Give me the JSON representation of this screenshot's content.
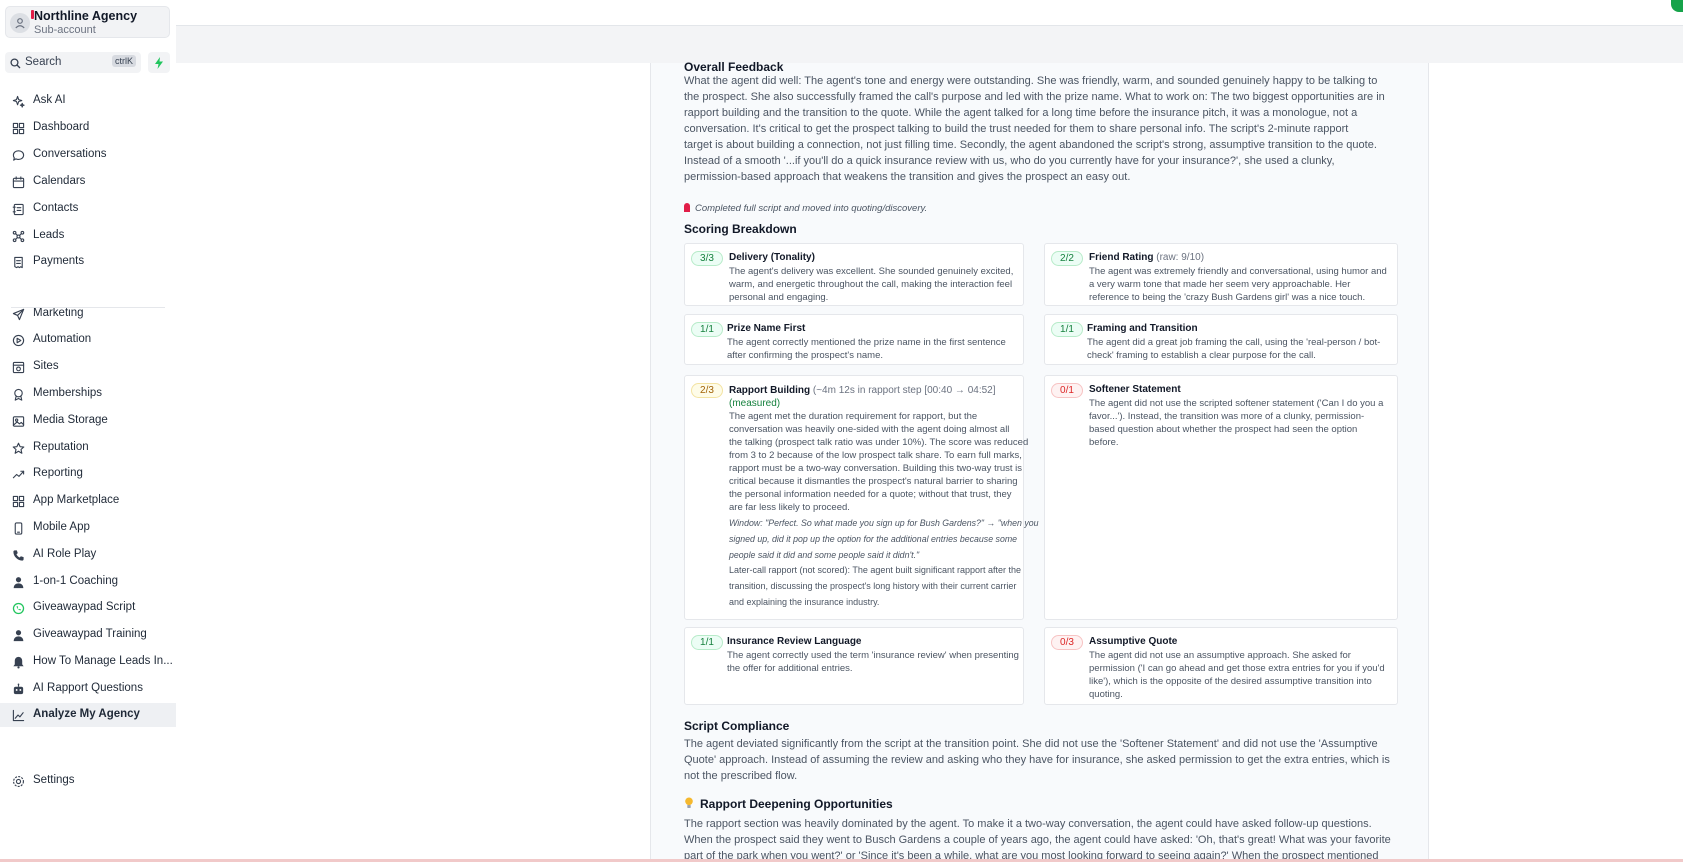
{
  "account": {
    "name": "Northline Agency",
    "subtitle": "Sub-account"
  },
  "search": {
    "label": "Search",
    "shortcut": "ctrlK"
  },
  "nav": [
    {
      "label": "Ask AI",
      "icon": "sparkle-icon"
    },
    {
      "label": "Dashboard",
      "icon": "grid-icon"
    },
    {
      "label": "Conversations",
      "icon": "chat-bubble-icon"
    },
    {
      "label": "Calendars",
      "icon": "calendar-icon"
    },
    {
      "label": "Contacts",
      "icon": "contacts-icon"
    },
    {
      "label": "Leads",
      "icon": "network-icon"
    },
    {
      "label": "Payments",
      "icon": "receipt-icon"
    },
    {
      "label": "Marketing",
      "icon": "send-icon"
    },
    {
      "label": "Automation",
      "icon": "automation-icon"
    },
    {
      "label": "Sites",
      "icon": "sites-icon"
    },
    {
      "label": "Memberships",
      "icon": "award-icon"
    },
    {
      "label": "Media Storage",
      "icon": "image-icon"
    },
    {
      "label": "Reputation",
      "icon": "star-icon"
    },
    {
      "label": "Reporting",
      "icon": "trend-icon"
    },
    {
      "label": "App Marketplace",
      "icon": "apps-icon"
    },
    {
      "label": "Mobile App",
      "icon": "phone-icon"
    },
    {
      "label": "AI Role Play",
      "icon": "phone-call-icon"
    },
    {
      "label": "1-on-1 Coaching",
      "icon": "person-icon"
    },
    {
      "label": "Giveawaypad Script",
      "icon": "whatsapp-icon"
    },
    {
      "label": "Giveawaypad Training",
      "icon": "person-icon"
    },
    {
      "label": "How To Manage Leads In...",
      "icon": "bell-icon"
    },
    {
      "label": "AI Rapport Questions",
      "icon": "robot-icon"
    },
    {
      "label": "Analyze My Agency",
      "icon": "chart-line-icon"
    }
  ],
  "settings": {
    "label": "Settings"
  },
  "feedback": {
    "overall_title": "Overall Feedback",
    "overall_lines": [
      "What the agent did well: The agent's tone and energy were outstanding. She was friendly, warm, and sounded genuinely happy to be talking to",
      "the prospect. She also successfully framed the call's purpose and led with the prize name. What to work on: The two biggest opportunities are in",
      "rapport building and the transition to the quote. While the agent talked for a long time before the insurance pitch, it was a monologue, not a",
      "conversation. It's critical to get the prospect talking to build the trust needed for them to share personal info. The script's 2-minute rapport",
      "target is about building a connection, not just filling time. Secondly, the agent abandoned the script's strong, assumptive transition to the quote.",
      "Instead of a smooth '...if you'll do a quick insurance review with us, who do you currently have for your insurance?', she used a clunky,",
      "permission-based approach that weakens the transition and gives the prospect an easy out."
    ],
    "note": "Completed full script and moved into quoting/discovery.",
    "scoring_title": "Scoring Breakdown",
    "cards": {
      "delivery": {
        "score": "3/3",
        "title": "Delivery (Tonality)",
        "lines": [
          "The agent's delivery was excellent. She sounded genuinely excited,",
          "warm, and energetic throughout the call, making the interaction feel",
          "personal and engaging."
        ]
      },
      "friend": {
        "score": "2/2",
        "title": "Friend Rating",
        "sub": "(raw: 9/10)",
        "lines": [
          "The agent was extremely friendly and conversational, using humor and",
          "a very warm tone that made her seem very approachable. Her",
          "reference to being the 'crazy Bush Gardens girl' was a nice touch."
        ]
      },
      "prize": {
        "score": "1/1",
        "title": "Prize Name First",
        "lines": [
          "The agent correctly mentioned the prize name in the first sentence",
          "after confirming the prospect's name."
        ]
      },
      "framing": {
        "score": "1/1",
        "title": "Framing and Transition",
        "lines": [
          "The agent did a great job framing the call, using the 'real-person / bot-",
          "check' framing to establish a clear purpose for the call."
        ]
      },
      "rapport": {
        "score": "2/3",
        "title": "Rapport Building",
        "sub": "(~4m 12s in rapport step [00:40 → 04:52]",
        "measured": "(measured)",
        "lines": [
          "The agent met the duration requirement for rapport, but the",
          "conversation was heavily one-sided with the agent doing almost all",
          "the talking (prospect talk ratio was under 10%). The score was reduced",
          "from 3 to 2 because of the low prospect talk share. To earn full marks,",
          "rapport must be a two-way conversation. Building this two-way trust is",
          "critical because it dismantles the prospect's natural barrier to sharing",
          "the personal information needed for a quote; without that trust, they",
          "are far less likely to proceed."
        ],
        "window_lines": [
          "Window: \"Perfect. So what made you sign up for Bush Gardens?\" → \"when you",
          "signed up, did it pop up the option for the additional entries because some",
          "people said it did and some people said it didn't.\""
        ],
        "later_lines": [
          "Later-call rapport (not scored): The agent built significant rapport after the",
          "transition, discussing the prospect's long history with their current carrier",
          "and explaining the insurance industry."
        ]
      },
      "softener": {
        "score": "0/1",
        "title": "Softener Statement",
        "lines": [
          "The agent did not use the scripted softener statement ('Can I do you a",
          "favor...'). Instead, the transition was more of a clunky, permission-",
          "based question about whether the prospect had seen the option",
          "before."
        ]
      },
      "insurance": {
        "score": "1/1",
        "title": "Insurance Review Language",
        "lines": [
          "The agent correctly used the term 'insurance review' when presenting",
          "the offer for additional entries."
        ]
      },
      "assumptive": {
        "score": "0/3",
        "title": "Assumptive Quote",
        "lines": [
          "The agent did not use an assumptive approach. She asked for",
          "permission ('I can go ahead and get those extra entries for you if you'd",
          "like'), which is the opposite of the desired assumptive transition into",
          "quoting."
        ]
      }
    },
    "compliance_title": "Script Compliance",
    "compliance_lines": [
      "The agent deviated significantly from the script at the transition point. She did not use the 'Softener Statement' and did not use the 'Assumptive",
      "Quote' approach. Instead of assuming the review and asking who they have for insurance, she asked permission to get the extra entries, which is",
      "not the prescribed flow."
    ],
    "deepening_title": "Rapport Deepening Opportunities",
    "deepening_lines": [
      "The rapport section was heavily dominated by the agent. To make it a two-way conversation, the agent could have asked follow-up questions.",
      "When the prospect said they went to Busch Gardens a couple of years ago, the agent could have asked: 'Oh, that's great! What was your favorite",
      "part of the park when you went?' or 'Since it's been a while, what are you most looking forward to seeing again?' When the prospect mentioned"
    ]
  },
  "colors": {
    "accent_green": "#16a34a",
    "badge_green": "#15803d",
    "badge_yellow": "#a16207",
    "badge_red": "#dc2626"
  }
}
